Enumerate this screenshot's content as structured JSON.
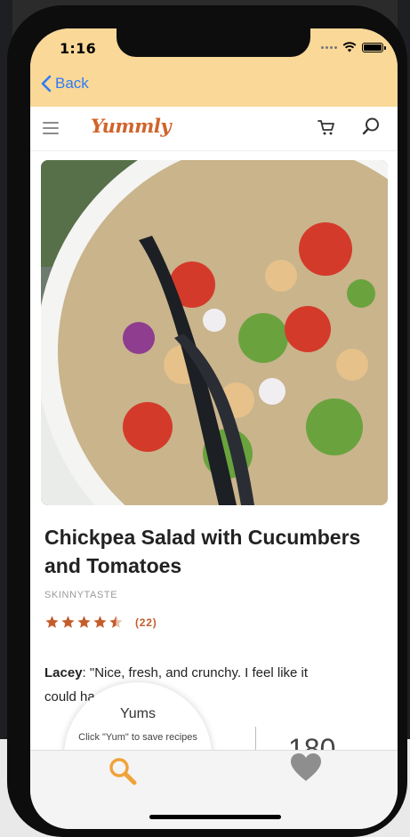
{
  "status": {
    "time": "1:16"
  },
  "nav": {
    "back_label": "Back"
  },
  "header": {
    "logo_text": "Yummly"
  },
  "recipe": {
    "title": "Chickpea Salad with Cucumbers and Tomatoes",
    "source": "SKINNYTASTE",
    "rating": 4.5,
    "rating_max": 5,
    "rating_count": "(22)",
    "review_author": "Lacey",
    "review_text": ": \"Nice, fresh, and crunchy. I feel like it could ha...",
    "stat_value": "180"
  },
  "yum_bubble": {
    "title": "Yums",
    "text": "Click \"Yum\" to save recipes"
  },
  "tabbar": {
    "tabs": [
      {
        "icon": "magnifier-icon",
        "active": true
      },
      {
        "icon": "heart-icon",
        "active": false
      }
    ]
  },
  "colors": {
    "status_bar": "#fad897",
    "accent": "#d1632b",
    "link": "#2d7cf6",
    "star": "#c45c2b",
    "tab_active": "#f0a23a",
    "tab_inactive": "#8e8e8e"
  }
}
